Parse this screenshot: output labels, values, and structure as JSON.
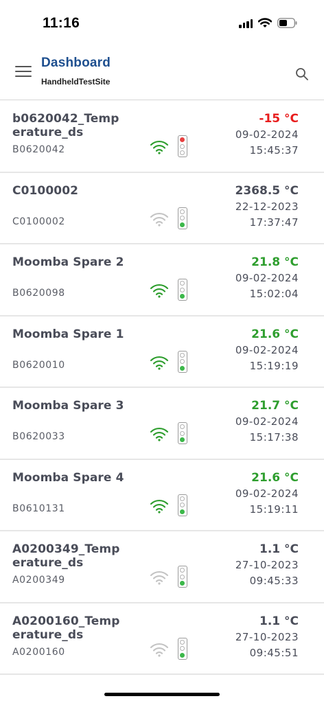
{
  "status_bar": {
    "time": "11:16"
  },
  "header": {
    "title": "Dashboard",
    "subtitle": "HandheldTestSite"
  },
  "colors": {
    "green": "#2e9e2e",
    "red": "#e81c1c",
    "gray": "#c4c4c4",
    "dark": "#4a4d59"
  },
  "devices": [
    {
      "name": "b0620042_Temperature_ds",
      "id": "B0620042",
      "temp": "-15 °C",
      "temp_status": "red",
      "date": "09-02-2024",
      "time": "15:45:37",
      "wifi": "online",
      "traffic_light": "red"
    },
    {
      "name": "C0100002",
      "id": "C0100002",
      "temp": "2368.5 °C",
      "temp_status": "normal",
      "date": "22-12-2023",
      "time": "17:37:47",
      "wifi": "offline",
      "traffic_light": "green"
    },
    {
      "name": "Moomba Spare 2",
      "id": "B0620098",
      "temp": "21.8 °C",
      "temp_status": "green",
      "date": "09-02-2024",
      "time": "15:02:04",
      "wifi": "online",
      "traffic_light": "green"
    },
    {
      "name": "Moomba Spare 1",
      "id": "B0620010",
      "temp": "21.6 °C",
      "temp_status": "green",
      "date": "09-02-2024",
      "time": "15:19:19",
      "wifi": "online",
      "traffic_light": "green"
    },
    {
      "name": "Moomba Spare 3",
      "id": "B0620033",
      "temp": "21.7 °C",
      "temp_status": "green",
      "date": "09-02-2024",
      "time": "15:17:38",
      "wifi": "online",
      "traffic_light": "green"
    },
    {
      "name": "Moomba Spare 4",
      "id": "B0610131",
      "temp": "21.6 °C",
      "temp_status": "green",
      "date": "09-02-2024",
      "time": "15:19:11",
      "wifi": "online",
      "traffic_light": "green"
    },
    {
      "name": "A0200349_Temperature_ds",
      "id": "A0200349",
      "temp": "1.1 °C",
      "temp_status": "normal",
      "date": "27-10-2023",
      "time": "09:45:33",
      "wifi": "offline",
      "traffic_light": "green"
    },
    {
      "name": "A0200160_Temperature_ds",
      "id": "A0200160",
      "temp": "1.1 °C",
      "temp_status": "normal",
      "date": "27-10-2023",
      "time": "09:45:51",
      "wifi": "offline",
      "traffic_light": "green"
    }
  ]
}
